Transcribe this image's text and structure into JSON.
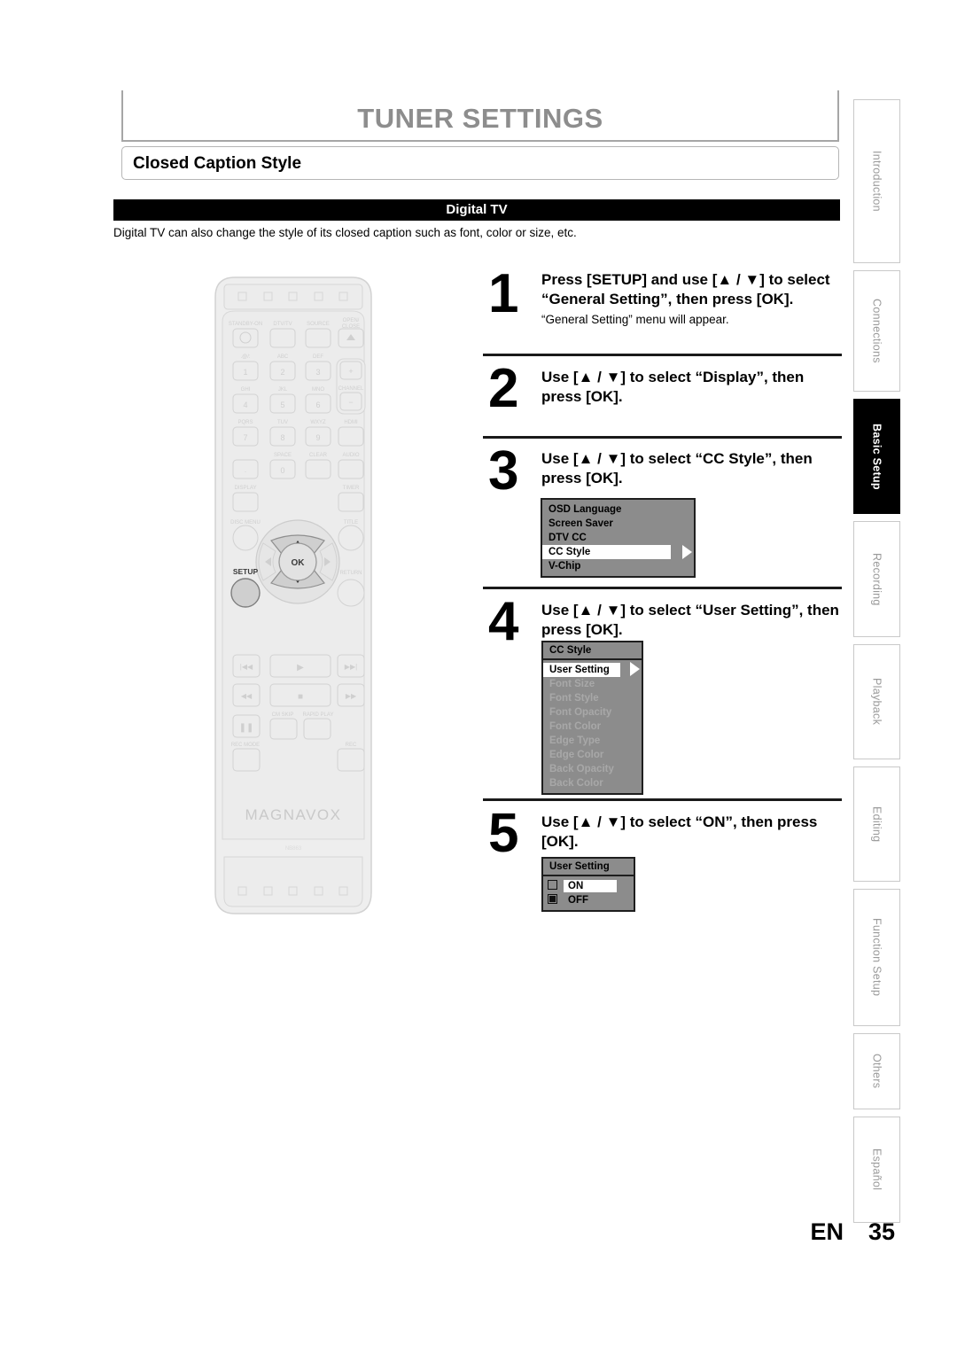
{
  "header": {
    "title": "TUNER SETTINGS",
    "subtitle": "Closed Caption Style",
    "section_bar": "Digital TV",
    "intro": "Digital TV can also change the style of its closed caption such as font, color or size, etc."
  },
  "tabs": [
    {
      "label": "Introduction",
      "active": false
    },
    {
      "label": "Connections",
      "active": false
    },
    {
      "label": "Basic Setup",
      "active": true
    },
    {
      "label": "Recording",
      "active": false
    },
    {
      "label": "Playback",
      "active": false
    },
    {
      "label": "Editing",
      "active": false
    },
    {
      "label": "Function Setup",
      "active": false
    },
    {
      "label": "Others",
      "active": false
    },
    {
      "label": "Español",
      "active": false
    }
  ],
  "steps": [
    {
      "number": "1",
      "head": "Press [SETUP] and use [▲ / ▼] to select “General Setting”, then press [OK].",
      "sub": "“General Setting” menu will appear."
    },
    {
      "number": "2",
      "head": "Use [▲ / ▼] to select “Display”, then press [OK].",
      "sub": ""
    },
    {
      "number": "3",
      "head": "Use [▲ / ▼] to select “CC Style”, then press [OK].",
      "sub": ""
    },
    {
      "number": "4",
      "head": "Use [▲ / ▼] to select “User Setting”, then press [OK].",
      "sub": ""
    },
    {
      "number": "5",
      "head": "Use [▲ / ▼] to select “ON”, then press [OK].",
      "sub": ""
    }
  ],
  "osd_display_menu": {
    "items": [
      {
        "label": "OSD Language",
        "selected": false,
        "dim": false
      },
      {
        "label": "Screen Saver",
        "selected": false,
        "dim": false
      },
      {
        "label": "DTV CC",
        "selected": false,
        "dim": false
      },
      {
        "label": "CC Style",
        "selected": true,
        "dim": false
      },
      {
        "label": "V-Chip",
        "selected": false,
        "dim": false
      }
    ]
  },
  "osd_ccstyle_menu": {
    "title": "CC Style",
    "items": [
      {
        "label": "User Setting",
        "selected": true,
        "dim": false
      },
      {
        "label": "Font Size",
        "selected": false,
        "dim": true
      },
      {
        "label": "Font Style",
        "selected": false,
        "dim": true
      },
      {
        "label": "Font Opacity",
        "selected": false,
        "dim": true
      },
      {
        "label": "Font Color",
        "selected": false,
        "dim": true
      },
      {
        "label": "Edge Type",
        "selected": false,
        "dim": true
      },
      {
        "label": "Edge Color",
        "selected": false,
        "dim": true
      },
      {
        "label": "Back Opacity",
        "selected": false,
        "dim": true
      },
      {
        "label": "Back Color",
        "selected": false,
        "dim": true
      }
    ]
  },
  "osd_usersetting_menu": {
    "title": "User Setting",
    "options": [
      {
        "label": "ON",
        "checked": false,
        "selected": true
      },
      {
        "label": "OFF",
        "checked": true,
        "selected": false
      }
    ]
  },
  "remote": {
    "brand": "MAGNAVOX",
    "model": "NB863",
    "labels": {
      "standby": "STANDBY-ON",
      "dtv_tv": "DTV/TV",
      "source": "SOURCE",
      "open_close": "OPEN/ CLOSE",
      "k1": ".@/:",
      "k2": "ABC",
      "k3": "DEF",
      "k4": "GHI",
      "k5": "JKL",
      "k6": "MNO",
      "k7": "PQRS",
      "k8": "TUV",
      "k9": "WXYZ",
      "channel": "CHANNEL",
      "hdmi": "HDMI",
      "space": "SPACE",
      "clear": "CLEAR",
      "audio": "AUDIO",
      "display": "DISPLAY",
      "timer": "TIMER",
      "disc_menu": "DISC MENU",
      "title": "TITLE",
      "setup": "SETUP",
      "return": "RETURN",
      "ok": "OK",
      "cm_skip": "CM SKIP",
      "rapid_play": "RAPID PLAY",
      "rec_mode": "REC MODE",
      "rec": "REC",
      "n1": "1",
      "n2": "2",
      "n3": "3",
      "n4": "4",
      "n5": "5",
      "n6": "6",
      "n7": "7",
      "n8": "8",
      "n9": "9",
      "n0": "0",
      "dot": ".",
      "plus": "+",
      "minus": "−"
    }
  },
  "footer": {
    "lang": "EN",
    "page": "35"
  }
}
